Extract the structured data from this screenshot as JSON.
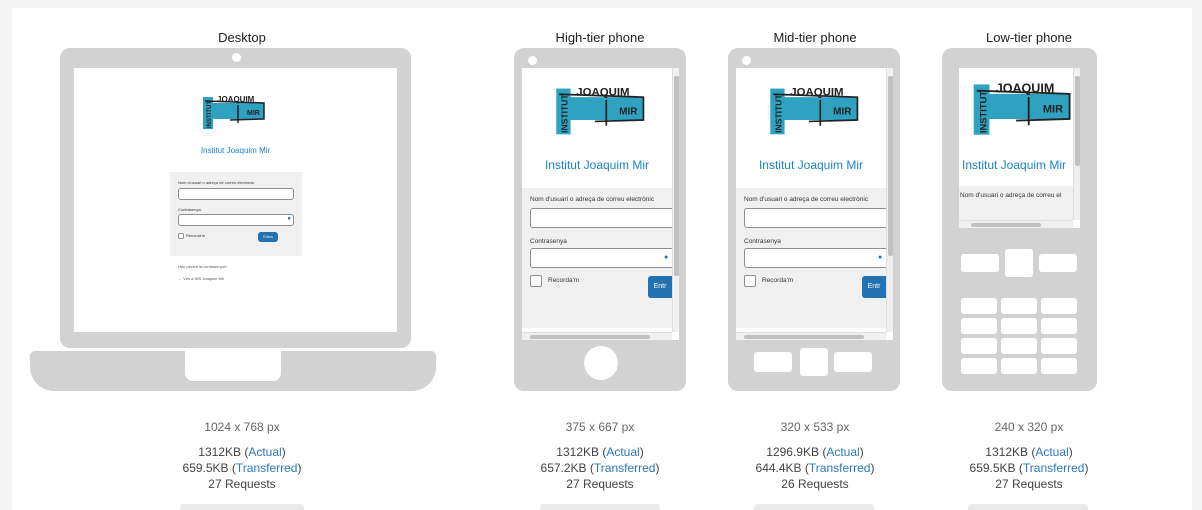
{
  "devices": [
    {
      "name": "Desktop",
      "dimensions": "1024 x 768 px",
      "size_actual": "1312KB",
      "size_transferred": "659.5KB",
      "requests": "27 Requests"
    },
    {
      "name": "High-tier phone",
      "dimensions": "375 x 667 px",
      "size_actual": "1312KB",
      "size_transferred": "657.2KB",
      "requests": "27 Requests"
    },
    {
      "name": "Mid-tier phone",
      "dimensions": "320 x 533 px",
      "size_actual": "1296.9KB",
      "size_transferred": "644.4KB",
      "requests": "26 Requests"
    },
    {
      "name": "Low-tier phone",
      "dimensions": "240 x 320 px",
      "size_actual": "1312KB",
      "size_transferred": "659.5KB",
      "requests": "27 Requests"
    }
  ],
  "labels": {
    "actual": "Actual",
    "transferred": "Transferred"
  },
  "site": {
    "logo_text_top": "JOAQUIM",
    "logo_text_side": "INSTITUT",
    "logo_text_mid": "MIR",
    "title": "Institut Joaquim Mir",
    "username_label": "Nom d'usuari o adreça de correu electrònic",
    "username_label_short": "Nom d'usuari o adreça de correu el",
    "password_label": "Contrasenya",
    "remember_label": "Recorda'm",
    "login_button": "Entra",
    "login_button_clipped": "Entr",
    "lost_password": "Heu perdut la contrasenya?",
    "back_link": "← Vés a INS Joaquim Mir"
  },
  "colors": {
    "accent": "#2271b1",
    "link": "#2a7ab8",
    "device": "#d2d2d2",
    "title": "#1a84c7"
  }
}
